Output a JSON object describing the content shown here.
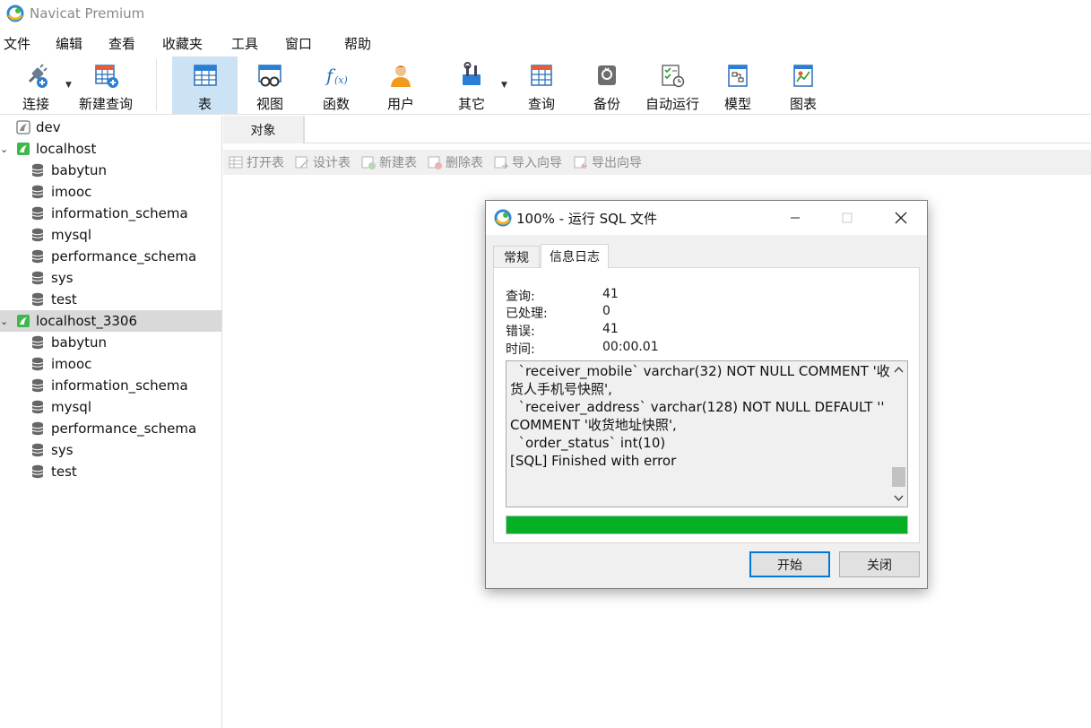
{
  "app": {
    "title": "Navicat Premium"
  },
  "menu": [
    "文件",
    "编辑",
    "查看",
    "收藏夹",
    "工具",
    "窗口",
    "帮助"
  ],
  "toolbar": {
    "connect": "连接",
    "new_query": "新建查询",
    "table": "表",
    "view": "视图",
    "function": "函数",
    "user": "用户",
    "other": "其它",
    "query": "查询",
    "backup": "备份",
    "automation": "自动运行",
    "model": "模型",
    "chart": "图表"
  },
  "sidebar": {
    "connections": [
      {
        "name": "dev",
        "expanded": false,
        "databases": []
      },
      {
        "name": "localhost",
        "expanded": true,
        "databases": [
          "babytun",
          "imooc",
          "information_schema",
          "mysql",
          "performance_schema",
          "sys",
          "test"
        ]
      },
      {
        "name": "localhost_3306",
        "expanded": true,
        "selected": true,
        "databases": [
          "babytun",
          "imooc",
          "information_schema",
          "mysql",
          "performance_schema",
          "sys",
          "test"
        ]
      }
    ]
  },
  "main": {
    "tab_objects": "对象",
    "object_toolbar": {
      "open_table": "打开表",
      "design_table": "设计表",
      "new_table": "新建表",
      "delete_table": "删除表",
      "import_wizard": "导入向导",
      "export_wizard": "导出向导"
    }
  },
  "dialog": {
    "title": "100% - 运行 SQL 文件",
    "tabs": {
      "general": "常规",
      "log": "信息日志"
    },
    "stats": {
      "query_label": "查询:",
      "query_value": "41",
      "processed_label": "已处理:",
      "processed_value": "0",
      "errors_label": "错误:",
      "errors_value": "41",
      "time_label": "时间:",
      "time_value": "00:00.01"
    },
    "log_lines": [
      "  `receiver_mobile` varchar(32) NOT NULL COMMENT '收",
      "货人手机号快照',",
      "  `receiver_address` varchar(128) NOT NULL DEFAULT ''",
      "COMMENT '收货地址快照',",
      "  `order_status` int(10)",
      "[SQL] Finished with error"
    ],
    "progress_percent": 100,
    "start_button": "开始",
    "close_button": "关闭"
  },
  "colors": {
    "progress": "#06b025",
    "toolbar_active": "#cce3f6",
    "accent": "#0078d7"
  }
}
